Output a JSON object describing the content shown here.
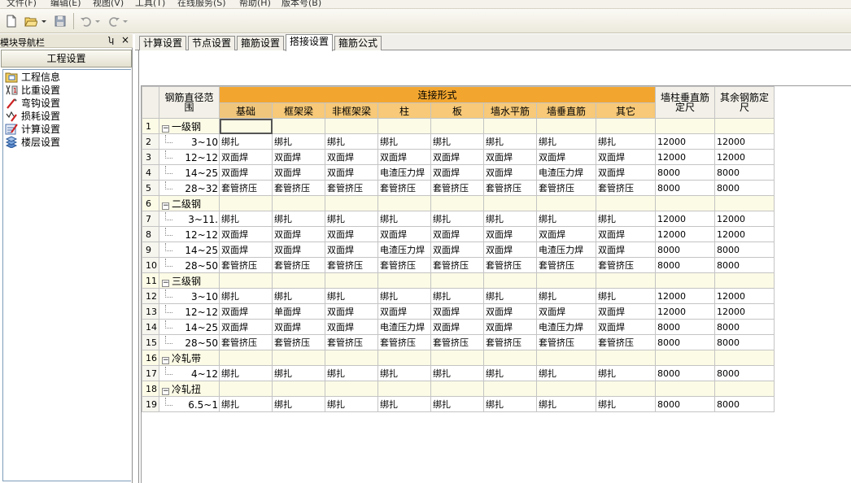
{
  "menu": [
    "文件(F)",
    "编辑(E)",
    "视图(V)",
    "工具(T)",
    "在线服务(S)",
    "帮助(H)",
    "版本号(B)"
  ],
  "navigator": {
    "title": "模块导航栏",
    "pin": "ʮ",
    "close": "×",
    "group": "工程设置",
    "items": [
      {
        "label": "工程信息",
        "icon": "folder-icon"
      },
      {
        "label": "比重设置",
        "icon": "weight-icon"
      },
      {
        "label": "弯钩设置",
        "icon": "hook-icon"
      },
      {
        "label": "损耗设置",
        "icon": "loss-icon"
      },
      {
        "label": "计算设置",
        "icon": "calc-icon"
      },
      {
        "label": "楼层设置",
        "icon": "floor-icon"
      }
    ]
  },
  "tabs": [
    "计算设置",
    "节点设置",
    "箍筋设置",
    "搭接设置",
    "箍筋公式"
  ],
  "active_tab": 3,
  "grid": {
    "range_header": "钢筋直径范围",
    "group_header": "连接形式",
    "sub_headers": [
      "基础",
      "框架梁",
      "非框架梁",
      "柱",
      "板",
      "墙水平筋",
      "墙垂直筋",
      "其它"
    ],
    "extra_headers": [
      "墙柱垂直筋定尺",
      "其余钢筋定尺"
    ],
    "rows": [
      {
        "no": "1",
        "type": "group",
        "label": "一级钢"
      },
      {
        "no": "2",
        "type": "item",
        "range": "3~10",
        "values": [
          "绑扎",
          "绑扎",
          "绑扎",
          "绑扎",
          "绑扎",
          "绑扎",
          "绑扎",
          "绑扎",
          "12000",
          "12000"
        ]
      },
      {
        "no": "3",
        "type": "item",
        "range": "12~12",
        "values": [
          "双面焊",
          "双面焊",
          "双面焊",
          "双面焊",
          "双面焊",
          "双面焊",
          "双面焊",
          "双面焊",
          "12000",
          "12000"
        ]
      },
      {
        "no": "4",
        "type": "item",
        "range": "14~25",
        "values": [
          "双面焊",
          "双面焊",
          "双面焊",
          "电渣压力焊",
          "双面焊",
          "双面焊",
          "电渣压力焊",
          "双面焊",
          "8000",
          "8000"
        ]
      },
      {
        "no": "5",
        "type": "item",
        "range": "28~32",
        "values": [
          "套管挤压",
          "套管挤压",
          "套管挤压",
          "套管挤压",
          "套管挤压",
          "套管挤压",
          "套管挤压",
          "套管挤压",
          "8000",
          "8000"
        ]
      },
      {
        "no": "6",
        "type": "group",
        "label": "二级钢"
      },
      {
        "no": "7",
        "type": "item",
        "range": "3~11.",
        "values": [
          "绑扎",
          "绑扎",
          "绑扎",
          "绑扎",
          "绑扎",
          "绑扎",
          "绑扎",
          "绑扎",
          "12000",
          "12000"
        ]
      },
      {
        "no": "8",
        "type": "item",
        "range": "12~12",
        "values": [
          "双面焊",
          "双面焊",
          "双面焊",
          "双面焊",
          "双面焊",
          "双面焊",
          "双面焊",
          "双面焊",
          "12000",
          "12000"
        ]
      },
      {
        "no": "9",
        "type": "item",
        "range": "14~25",
        "values": [
          "双面焊",
          "双面焊",
          "双面焊",
          "电渣压力焊",
          "双面焊",
          "双面焊",
          "电渣压力焊",
          "双面焊",
          "8000",
          "8000"
        ]
      },
      {
        "no": "10",
        "type": "item",
        "range": "28~50",
        "values": [
          "套管挤压",
          "套管挤压",
          "套管挤压",
          "套管挤压",
          "套管挤压",
          "套管挤压",
          "套管挤压",
          "套管挤压",
          "8000",
          "8000"
        ]
      },
      {
        "no": "11",
        "type": "group",
        "label": "三级钢"
      },
      {
        "no": "12",
        "type": "item",
        "range": "3~10",
        "values": [
          "绑扎",
          "绑扎",
          "绑扎",
          "绑扎",
          "绑扎",
          "绑扎",
          "绑扎",
          "绑扎",
          "12000",
          "12000"
        ]
      },
      {
        "no": "13",
        "type": "item",
        "range": "12~12",
        "values": [
          "双面焊",
          "单面焊",
          "双面焊",
          "双面焊",
          "双面焊",
          "双面焊",
          "双面焊",
          "双面焊",
          "12000",
          "12000"
        ]
      },
      {
        "no": "14",
        "type": "item",
        "range": "14~25",
        "values": [
          "双面焊",
          "双面焊",
          "双面焊",
          "电渣压力焊",
          "双面焊",
          "双面焊",
          "电渣压力焊",
          "双面焊",
          "8000",
          "8000"
        ]
      },
      {
        "no": "15",
        "type": "item",
        "range": "28~50",
        "values": [
          "套管挤压",
          "套管挤压",
          "套管挤压",
          "套管挤压",
          "套管挤压",
          "套管挤压",
          "套管挤压",
          "套管挤压",
          "8000",
          "8000"
        ]
      },
      {
        "no": "16",
        "type": "group",
        "label": "冷轧带"
      },
      {
        "no": "17",
        "type": "item",
        "range": "4~12",
        "values": [
          "绑扎",
          "绑扎",
          "绑扎",
          "绑扎",
          "绑扎",
          "绑扎",
          "绑扎",
          "绑扎",
          "8000",
          "8000"
        ]
      },
      {
        "no": "18",
        "type": "group",
        "label": "冷轧扭"
      },
      {
        "no": "19",
        "type": "item",
        "range": "6.5~1",
        "values": [
          "绑扎",
          "绑扎",
          "绑扎",
          "绑扎",
          "绑扎",
          "绑扎",
          "绑扎",
          "绑扎",
          "8000",
          "8000"
        ]
      }
    ]
  },
  "colors": {
    "group_header": "#f3a62f",
    "sub_header": "#f7c978",
    "group_row": "#fcfbe6"
  }
}
